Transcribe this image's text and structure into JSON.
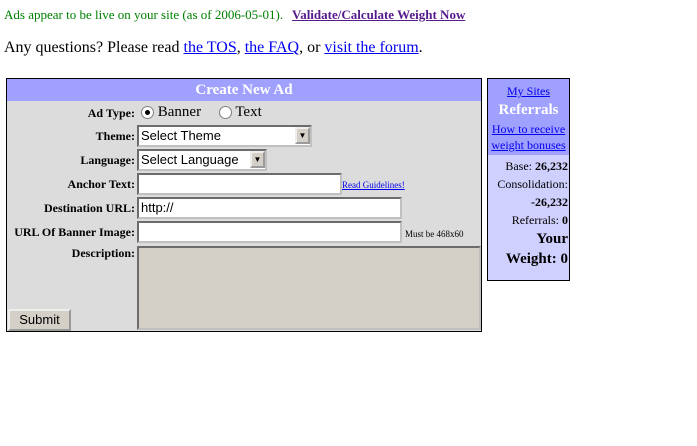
{
  "status": {
    "text": "Ads appear to be live on your site (as of 2006-05-01).",
    "validate_link": "Validate/Calculate Weight Now"
  },
  "questions": {
    "prefix": "Any questions? Please read ",
    "tos": "the TOS",
    "sep1": ", ",
    "faq": "the FAQ",
    "sep2": ", or ",
    "forum": "visit the forum",
    "suffix": "."
  },
  "form": {
    "title": "Create New Ad",
    "ad_type_label": "Ad Type:",
    "ad_type_options": [
      "Banner",
      "Text"
    ],
    "ad_type_selected": "Banner",
    "theme_label": "Theme:",
    "theme_value": "Select Theme",
    "language_label": "Language:",
    "language_value": "Select Language",
    "anchor_label": "Anchor Text:",
    "anchor_value": "",
    "guidelines_link": "Read Guidelines!",
    "dest_label": "Destination URL:",
    "dest_value": "http://",
    "banner_label": "URL Of Banner Image:",
    "banner_value": "",
    "banner_note": "Must be 468x60",
    "desc_label": "Description:",
    "desc_value": "",
    "submit": "Submit"
  },
  "sidebar": {
    "my_sites": "My Sites",
    "title": "Referrals",
    "how_to": "How to receive weight bonuses",
    "base_label": "Base: ",
    "base_value": "26,232",
    "consolidation_label": "Consolidation:",
    "consolidation_value": "-26,232",
    "referrals_label": "Referrals: ",
    "referrals_value": "0",
    "weight_label1": "Your",
    "weight_label2": "Weight: ",
    "weight_value": "0"
  }
}
